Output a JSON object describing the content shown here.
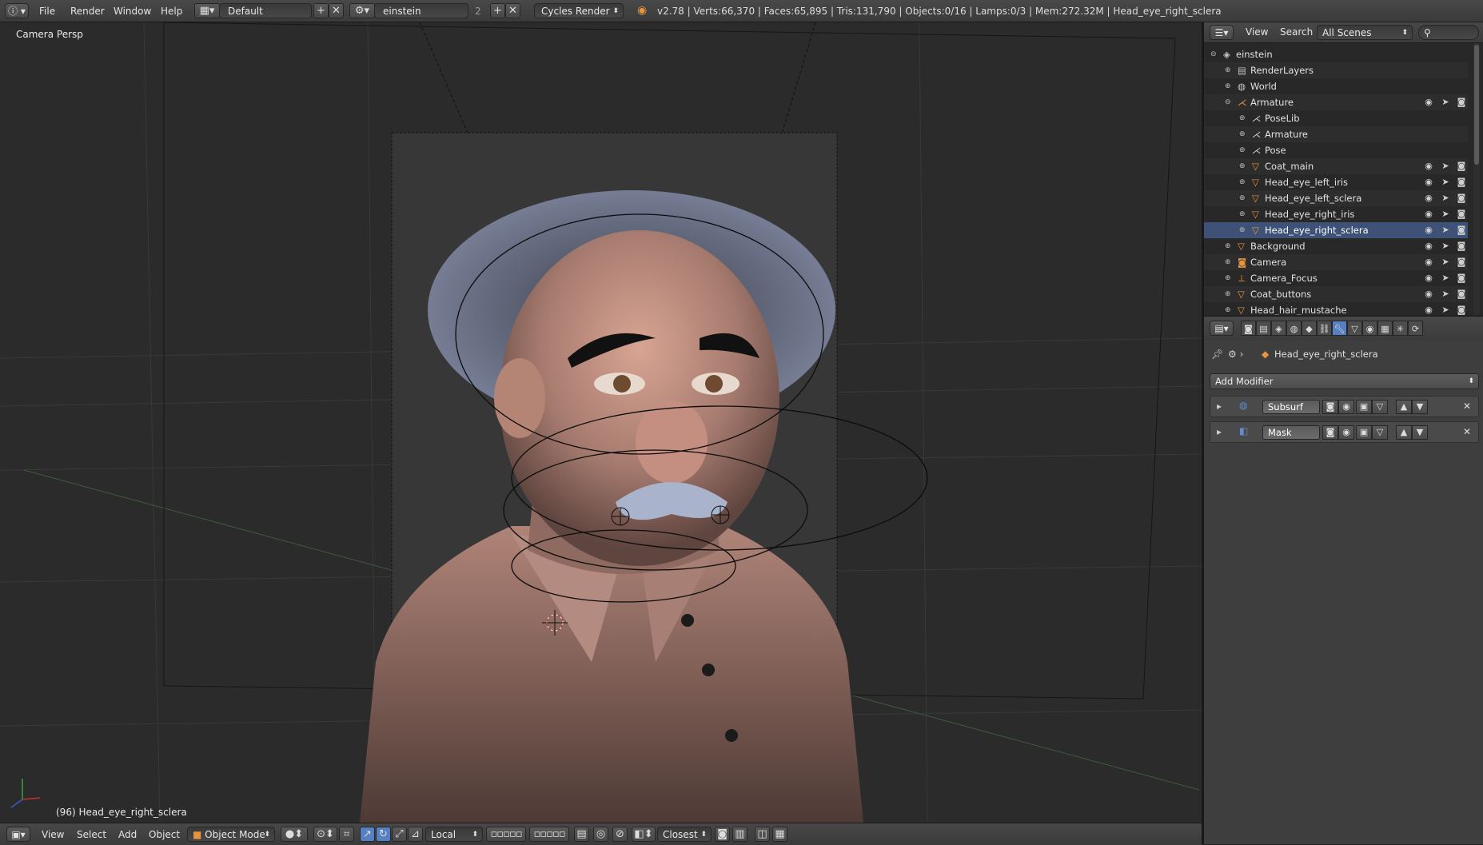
{
  "colors": {
    "accent_blue": "#5680c2",
    "selection": "#3d5276",
    "object_orange": "#e59540",
    "skin": "#a57a6e",
    "hair": "#8a93b0"
  },
  "topbar": {
    "menus": [
      "File",
      "Render",
      "Window",
      "Help"
    ],
    "screen_layout": "Default",
    "scene": "einstein",
    "scene_users": "2",
    "render_engine": "Cycles Render",
    "stats": "v2.78 | Verts:66,370 | Faces:65,895 | Tris:131,790 | Objects:0/16 | Lamps:0/3 | Mem:272.32M | Head_eye_right_sclera"
  },
  "viewport": {
    "view_name": "Camera Persp",
    "frame_object": "(96) Head_eye_right_sclera"
  },
  "bottombar": {
    "menus": [
      "View",
      "Select",
      "Add",
      "Object"
    ],
    "mode": "Object Mode",
    "orientation": "Local",
    "snap_target": "Closest"
  },
  "outliner": {
    "header_menus": [
      "View",
      "Search"
    ],
    "display_filter": "All Scenes",
    "rows": [
      {
        "label": "einstein",
        "icon": "scene-icon",
        "depth": 0,
        "expanded": true
      },
      {
        "label": "RenderLayers",
        "icon": "renderlayers-icon",
        "depth": 1
      },
      {
        "label": "World",
        "icon": "world-icon",
        "depth": 1
      },
      {
        "label": "Armature",
        "icon": "armature-icon",
        "depth": 1,
        "expanded": true
      },
      {
        "label": "PoseLib",
        "icon": "poselib-icon",
        "depth": 2
      },
      {
        "label": "Armature",
        "icon": "armature-data-icon",
        "depth": 2
      },
      {
        "label": "Pose",
        "icon": "pose-icon",
        "depth": 2
      },
      {
        "label": "Coat_main",
        "icon": "mesh-icon",
        "depth": 2
      },
      {
        "label": "Head_eye_left_iris",
        "icon": "mesh-icon",
        "depth": 2
      },
      {
        "label": "Head_eye_left_sclera",
        "icon": "mesh-icon",
        "depth": 2
      },
      {
        "label": "Head_eye_right_iris",
        "icon": "mesh-icon",
        "depth": 2
      },
      {
        "label": "Head_eye_right_sclera",
        "icon": "mesh-icon",
        "depth": 2,
        "selected": true
      },
      {
        "label": "Background",
        "icon": "mesh-icon",
        "depth": 1
      },
      {
        "label": "Camera",
        "icon": "camera-icon",
        "depth": 1
      },
      {
        "label": "Camera_Focus",
        "icon": "empty-icon",
        "depth": 1
      },
      {
        "label": "Coat_buttons",
        "icon": "mesh-icon",
        "depth": 1
      },
      {
        "label": "Head_hair_mustache",
        "icon": "mesh-icon",
        "depth": 1
      }
    ]
  },
  "properties": {
    "context_object": "Head_eye_right_sclera",
    "add_modifier_label": "Add Modifier",
    "modifiers": [
      {
        "name": "Subsurf",
        "icon": "subsurf-icon"
      },
      {
        "name": "Mask",
        "icon": "mask-icon"
      }
    ]
  }
}
